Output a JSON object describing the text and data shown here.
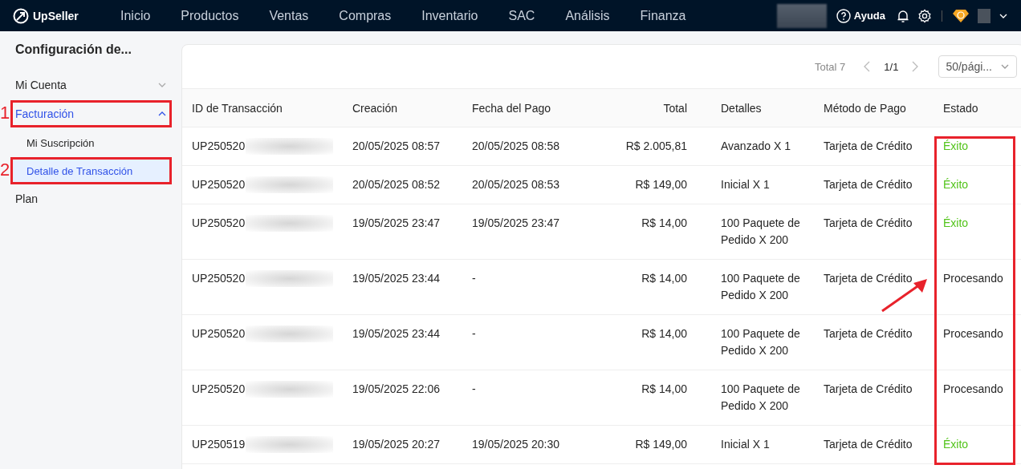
{
  "nav": {
    "brand": "UpSeller",
    "items": [
      {
        "label": "Inicio"
      },
      {
        "label": "Productos"
      },
      {
        "label": "Ventas"
      },
      {
        "label": "Compras"
      },
      {
        "label": "Inventario"
      },
      {
        "label": "SAC"
      },
      {
        "label": "Análisis"
      },
      {
        "label": "Finanza"
      }
    ],
    "help": "Ayuda"
  },
  "sidebar": {
    "title": "Configuración de...",
    "items": [
      {
        "label": "Mi Cuenta",
        "expanded": false,
        "annotated": false
      },
      {
        "label": "Facturación",
        "expanded": true,
        "annotated": true,
        "marker": "1",
        "children": [
          {
            "label": "Mi Suscripción",
            "selected": false,
            "annotated": false
          },
          {
            "label": "Detalle de Transacción",
            "selected": true,
            "annotated": true,
            "marker": "2"
          }
        ]
      },
      {
        "label": "Plan",
        "annotated": false
      }
    ]
  },
  "pager": {
    "total": "Total 7",
    "page": "1/1",
    "page_size": "50/pági..."
  },
  "table": {
    "columns": [
      "ID de Transacción",
      "Creación",
      "Fecha del Pago",
      "Total",
      "Detalles",
      "Método de Pago",
      "Estado"
    ],
    "status_annotated": true,
    "rows": [
      {
        "id": "UP250520",
        "created": "20/05/2025 08:57",
        "paid": "20/05/2025 08:58",
        "total": "R$ 2.005,81",
        "details": "Avanzado X 1",
        "method": "Tarjeta de Crédito",
        "status": "Éxito",
        "color": "#52c41a"
      },
      {
        "id": "UP250520",
        "created": "20/05/2025 08:52",
        "paid": "20/05/2025 08:53",
        "total": "R$ 149,00",
        "details": "Inicial X 1",
        "method": "Tarjeta de Crédito",
        "status": "Éxito",
        "color": "#52c41a"
      },
      {
        "id": "UP250520",
        "created": "19/05/2025 23:47",
        "paid": "19/05/2025 23:47",
        "total": "R$ 14,00",
        "details": "100 Paquete de Pedido X 200",
        "method": "Tarjeta de Crédito",
        "status": "Éxito",
        "color": "#52c41a"
      },
      {
        "id": "UP250520",
        "created": "19/05/2025 23:44",
        "paid": "-",
        "total": "R$ 14,00",
        "details": "100 Paquete de Pedido X 200",
        "method": "Tarjeta de Crédito",
        "status": "Procesando",
        "color": "#262626",
        "arrow": true
      },
      {
        "id": "UP250520",
        "created": "19/05/2025 23:44",
        "paid": "-",
        "total": "R$ 14,00",
        "details": "100 Paquete de Pedido X 200",
        "method": "Tarjeta de Crédito",
        "status": "Procesando",
        "color": "#262626"
      },
      {
        "id": "UP250520",
        "created": "19/05/2025 22:06",
        "paid": "-",
        "total": "R$ 14,00",
        "details": "100 Paquete de Pedido X 200",
        "method": "Tarjeta de Crédito",
        "status": "Procesando",
        "color": "#262626"
      },
      {
        "id": "UP250519",
        "created": "19/05/2025 20:27",
        "paid": "19/05/2025 20:30",
        "total": "R$ 149,00",
        "details": "Inicial X 1",
        "method": "Tarjeta de Crédito",
        "status": "Éxito",
        "color": "#52c41a"
      }
    ]
  }
}
